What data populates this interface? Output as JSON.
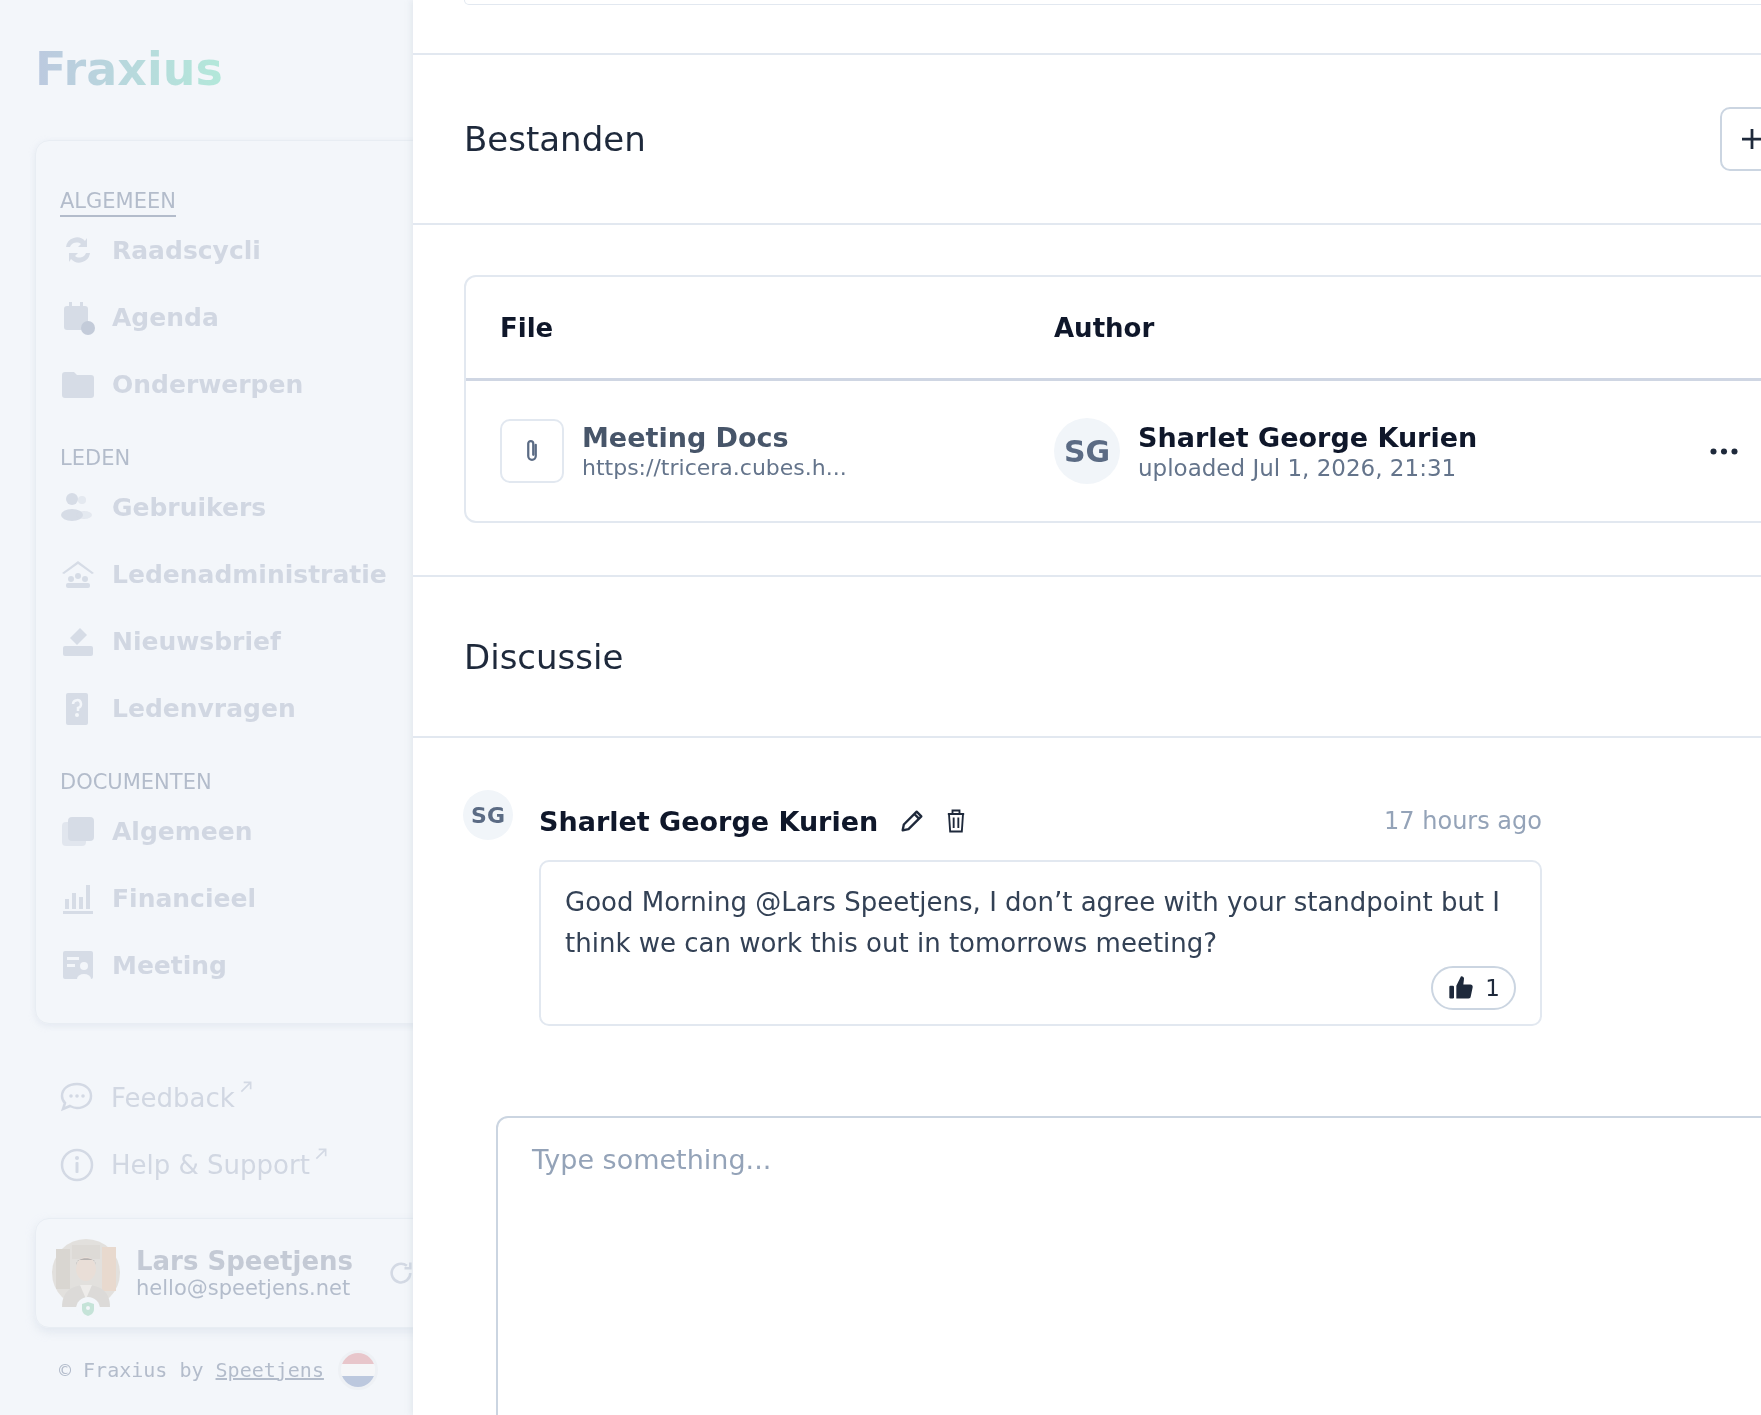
{
  "sidebar": {
    "logo": "Fraxius",
    "sections": [
      {
        "heading": "ALGEMEEN",
        "focused": true,
        "items": [
          "Raadscycli",
          "Agenda",
          "Onderwerpen"
        ]
      },
      {
        "heading": "LEDEN",
        "focused": false,
        "items": [
          "Gebruikers",
          "Ledenadministratie",
          "Nieuwsbrief",
          "Ledenvragen"
        ]
      },
      {
        "heading": "DOCUMENTEN",
        "focused": false,
        "items": [
          "Algemeen",
          "Financieel",
          "Meeting"
        ]
      }
    ],
    "links": [
      "Feedback",
      "Help & Support"
    ],
    "user": {
      "name": "Lars Speetjens",
      "email": "hello@speetjens.net"
    },
    "footer": {
      "text": "© Fraxius by",
      "link": "Speetjens"
    }
  },
  "files": {
    "title": "Bestanden",
    "columns": [
      "File",
      "Author"
    ],
    "rows": [
      {
        "name": "Meeting Docs",
        "url": "https://tricera.cubes.h...",
        "initials": "SG",
        "author": "Sharlet George Kurien",
        "uploaded": "uploaded Jul 1, 2026, 21:31"
      }
    ]
  },
  "discussion": {
    "title": "Discussie",
    "comments": [
      {
        "initials": "SG",
        "author": "Sharlet George Kurien",
        "time": "17 hours ago",
        "text": "Good Morning @Lars Speetjens, I don’t agree with your standpoint but I think we can work this out in tomorrows meeting?",
        "likes": "1"
      }
    ],
    "input": {
      "placeholder": "Type something..."
    }
  }
}
